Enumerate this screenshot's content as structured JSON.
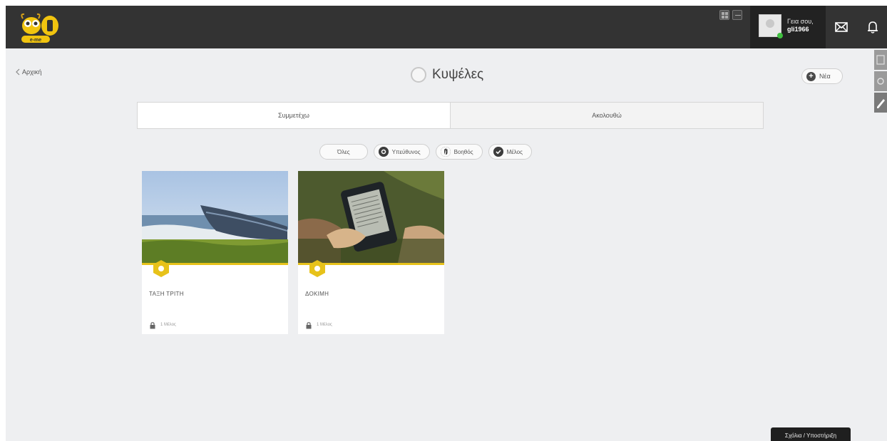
{
  "header": {
    "user_greeting": "Γεια σου,",
    "user_name": "gli1966"
  },
  "nav": {
    "back_label": "Αρχική"
  },
  "page": {
    "title": "Κυψέλες",
    "new_button_label": "Νέα"
  },
  "tabs": [
    {
      "label": "Συμμετέχω",
      "active": true
    },
    {
      "label": "Ακολουθώ",
      "active": false
    }
  ],
  "filters": [
    {
      "label": "Όλες",
      "icon": "none"
    },
    {
      "label": "Υπεύθυνος",
      "icon": "gear-icon"
    },
    {
      "label": "Βοηθός",
      "icon": "hand-icon"
    },
    {
      "label": "Μέλος",
      "icon": "check-icon"
    }
  ],
  "cards": [
    {
      "title": "ΤΑΞΗ ΤΡΙΤΗ",
      "members": "1 Μέλος",
      "image": "boat-on-beach"
    },
    {
      "title": "ΔΟΚΙΜΗ",
      "members": "1 Μέλος",
      "image": "ereader-in-hand"
    }
  ],
  "tooltip": {
    "text": "Σχόλια / Υποστήριξη"
  },
  "colors": {
    "topbar": "#333333",
    "accent_yellow": "#e7c21a",
    "background": "#eeeff1"
  }
}
